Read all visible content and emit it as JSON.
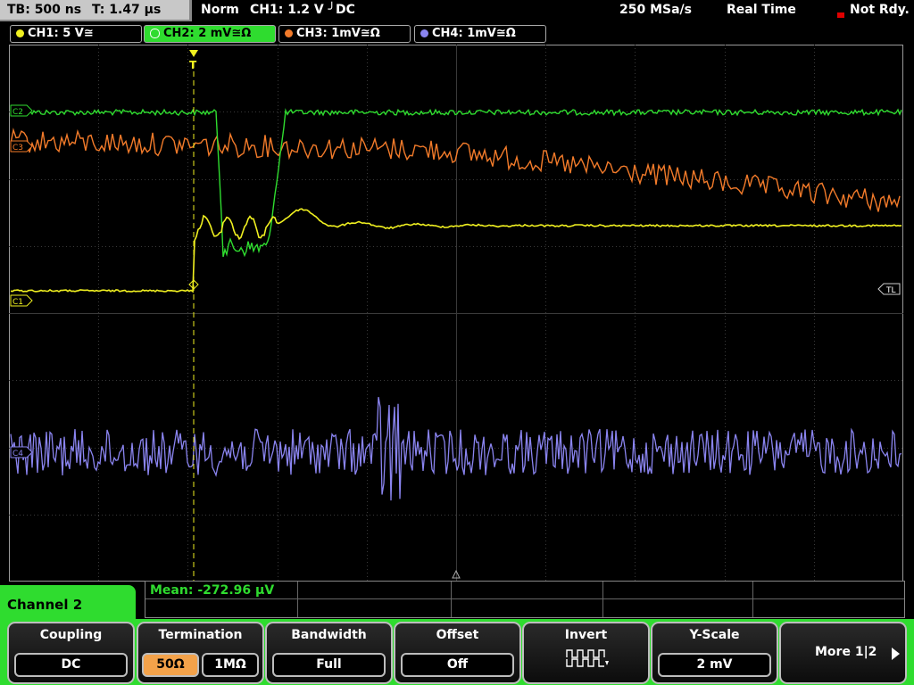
{
  "status": {
    "timebase": "TB: 500 ns",
    "time_offset": "T: 1.47 µs",
    "mode": "Norm",
    "trigger": "CH1: 1.2 V ╯DC",
    "sample_rate": "250 MSa/s",
    "acq_mode": "Real Time",
    "state": "Not Rdy."
  },
  "channels": [
    {
      "label": "CH1: 5 V≅",
      "color": "#f0f020"
    },
    {
      "label": "CH2: 2 mV≅Ω",
      "color": "#2fdc2f"
    },
    {
      "label": "CH3: 1mV≅Ω",
      "color": "#f37b2a"
    },
    {
      "label": "CH4: 1mV≅Ω",
      "color": "#8a84f0"
    }
  ],
  "markers": {
    "c2": "C2",
    "c3": "C3",
    "c1": "C1",
    "c4": "C4",
    "trigger_level": "TL",
    "trigger_pos": "T"
  },
  "measurement": {
    "text": "Mean: -272.96 µV"
  },
  "menu": {
    "title": "Channel 2"
  },
  "softkeys": {
    "coupling": {
      "title": "Coupling",
      "value": "DC"
    },
    "termination": {
      "title": "Termination",
      "opt1": "50Ω",
      "opt2": "1MΩ"
    },
    "bandwidth": {
      "title": "Bandwidth",
      "value": "Full"
    },
    "offset": {
      "title": "Offset",
      "value": "Off"
    },
    "invert": {
      "title": "Invert"
    },
    "yscale": {
      "title": "Y-Scale",
      "value": "2 mV"
    },
    "more": {
      "label": "More 1|2"
    }
  }
}
